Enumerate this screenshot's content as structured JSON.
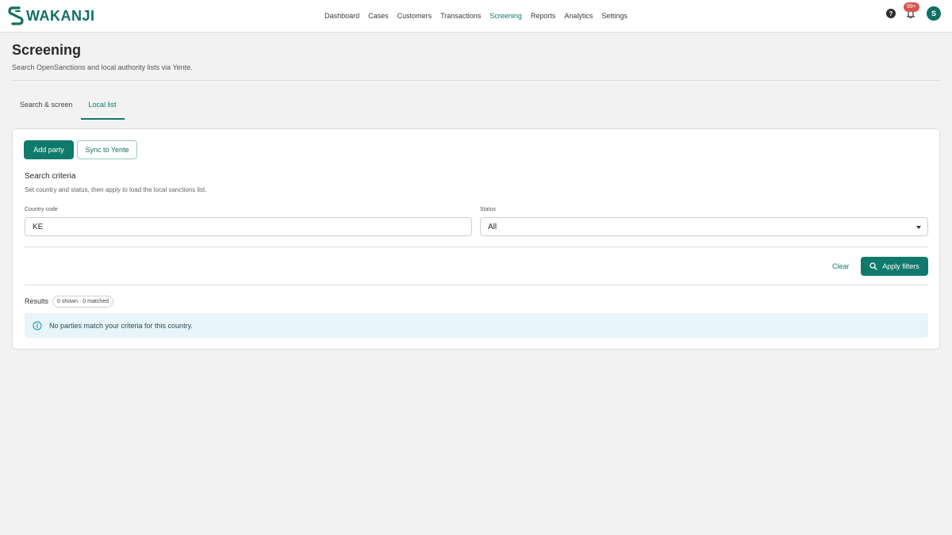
{
  "app": {
    "brand": "WAKANJI",
    "colors": {
      "accent": "#0f7a6b",
      "badge": "#d9534f",
      "info_bg": "#e7f4f9"
    }
  },
  "nav": {
    "items": [
      {
        "label": "Dashboard"
      },
      {
        "label": "Cases"
      },
      {
        "label": "Customers"
      },
      {
        "label": "Transactions"
      },
      {
        "label": "Screening",
        "active": true
      },
      {
        "label": "Reports"
      },
      {
        "label": "Analytics"
      },
      {
        "label": "Settings"
      }
    ]
  },
  "header_icons": {
    "help_glyph": "?",
    "notification_count": "99+",
    "avatar_initial": "S"
  },
  "page": {
    "title": "Screening",
    "subtitle": "Search OpenSanctions and local authority lists via Yente."
  },
  "tabs": [
    {
      "label": "Search & screen"
    },
    {
      "label": "Local list",
      "active": true
    }
  ],
  "actions": {
    "add_party": "Add party",
    "sync": "Sync to Yente"
  },
  "criteria": {
    "title": "Search criteria",
    "description": "Set country and status, then apply to load the local sanctions list.",
    "country_label": "Country code",
    "country_value": "KE",
    "status_label": "Status",
    "status_value": "All"
  },
  "filters": {
    "clear": "Clear",
    "apply": "Apply filters"
  },
  "results": {
    "label": "Results",
    "count": "0 shown · 0 matched",
    "empty_message": "No parties match your criteria for this country."
  }
}
